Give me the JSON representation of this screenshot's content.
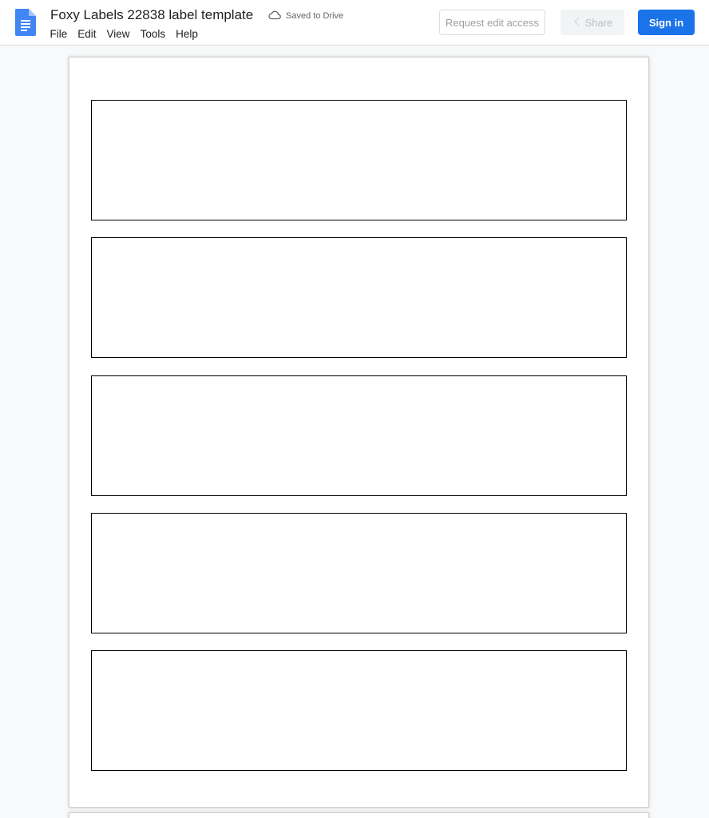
{
  "app": {
    "doc_title": "Foxy Labels 22838 label template",
    "save_status": "Saved to Drive",
    "icons": {
      "logo": "google-docs-icon",
      "cloud": "cloud-saved-icon",
      "share": "share-icon"
    },
    "colors": {
      "brand_blue": "#4285f4",
      "signin_blue": "#1a73e8"
    }
  },
  "menu": {
    "items": [
      "File",
      "Edit",
      "View",
      "Tools",
      "Help"
    ]
  },
  "actions": {
    "request_edit": "Request edit access",
    "share": "Share",
    "sign_in": "Sign in"
  },
  "document": {
    "labels": [
      "",
      "",
      "",
      "",
      ""
    ]
  }
}
